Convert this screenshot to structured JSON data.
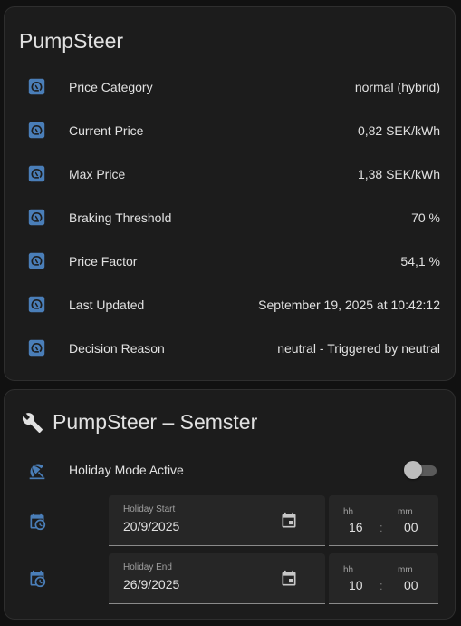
{
  "accent": "#4a7eb8",
  "card1": {
    "title": "PumpSteer",
    "rows": [
      {
        "label": "Price Category",
        "value": "normal (hybrid)",
        "icon": "gauge-icon"
      },
      {
        "label": "Current Price",
        "value": "0,82 SEK/kWh",
        "icon": "gauge-icon"
      },
      {
        "label": "Max Price",
        "value": "1,38 SEK/kWh",
        "icon": "gauge-icon"
      },
      {
        "label": "Braking Threshold",
        "value": "70 %",
        "icon": "gauge-icon"
      },
      {
        "label": "Price Factor",
        "value": "54,1 %",
        "icon": "gauge-icon"
      },
      {
        "label": "Last Updated",
        "value": "September 19, 2025 at 10:42:12",
        "icon": "gauge-icon"
      },
      {
        "label": "Decision Reason",
        "value": "neutral - Triggered by neutral",
        "icon": "gauge-icon"
      }
    ]
  },
  "card2": {
    "title": "PumpSteer – Semster",
    "title_icon": "wrench-icon",
    "holiday": {
      "label": "Holiday Mode Active",
      "icon": "beach-umbrella-icon",
      "active": false
    },
    "start": {
      "label": "Holiday Start",
      "date": "20/9/2025",
      "hh_label": "hh",
      "mm_label": "mm",
      "hh": "16",
      "mm": "00",
      "colon": ":"
    },
    "end": {
      "label": "Holiday End",
      "date": "26/9/2025",
      "hh_label": "hh",
      "mm_label": "mm",
      "hh": "10",
      "mm": "00",
      "colon": ":"
    }
  }
}
